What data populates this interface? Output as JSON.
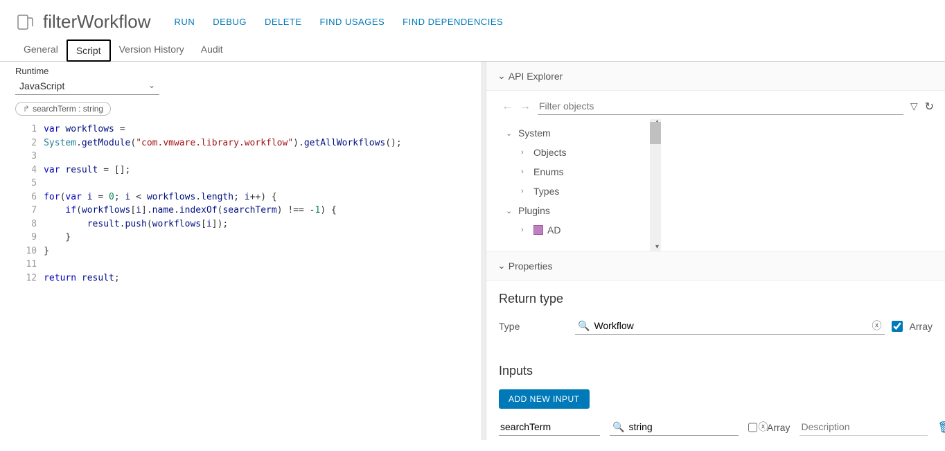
{
  "header": {
    "title": "filterWorkflow",
    "actions": [
      "RUN",
      "DEBUG",
      "DELETE",
      "FIND USAGES",
      "FIND DEPENDENCIES"
    ]
  },
  "tabs": [
    "General",
    "Script",
    "Version History",
    "Audit"
  ],
  "activeTab": "Script",
  "runtime": {
    "label": "Runtime",
    "value": "JavaScript",
    "chip": "searchTerm : string"
  },
  "code": {
    "lines": [
      "1",
      "2",
      "3",
      "4",
      "5",
      "6",
      "7",
      "8",
      "9",
      "10",
      "11",
      "12"
    ]
  },
  "apiExplorer": {
    "title": "API Explorer",
    "filterPlaceholder": "Filter objects",
    "tree": {
      "system": "System",
      "objects": "Objects",
      "enums": "Enums",
      "types": "Types",
      "plugins": "Plugins",
      "ad": "AD"
    }
  },
  "properties": {
    "title": "Properties",
    "returnType": {
      "title": "Return type",
      "typeLabel": "Type",
      "typeValue": "Workflow",
      "arrayLabel": "Array",
      "arrayChecked": true
    },
    "inputs": {
      "title": "Inputs",
      "addButton": "ADD NEW INPUT",
      "row": {
        "name": "searchTerm",
        "type": "string",
        "arrayLabel": "Array",
        "arrayChecked": false,
        "descPlaceholder": "Description"
      }
    }
  }
}
